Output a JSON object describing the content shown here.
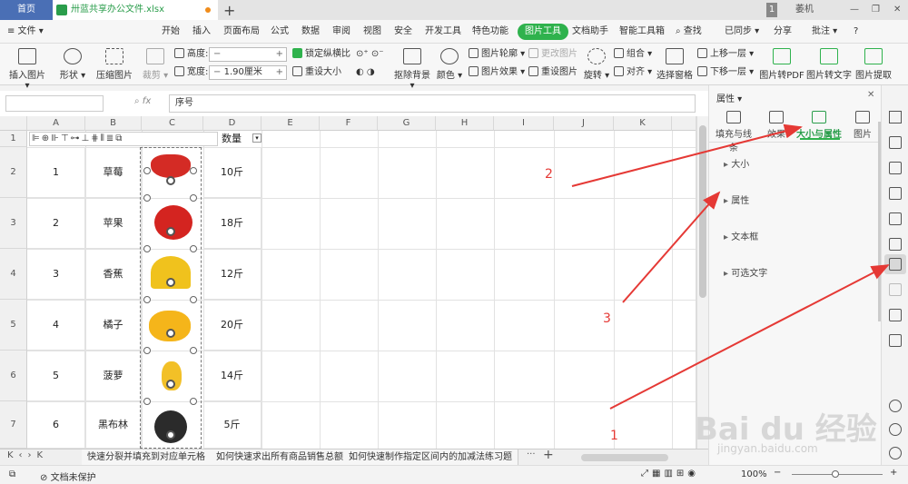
{
  "titlebar": {
    "home_tab": "首页",
    "file_tab": "卅蓝共享办公文件.xlsx",
    "plus": "+",
    "badge": "1",
    "user": "萎机"
  },
  "menubar": {
    "file": "≡ 文件 ▾",
    "items": [
      "开始",
      "插入",
      "页面布局",
      "公式",
      "数据",
      "审阅",
      "视图",
      "安全",
      "开发工具",
      "特色功能",
      "图片工具",
      "文档助手",
      "智能工具箱"
    ],
    "active": "图片工具",
    "search": "查找",
    "sync": "已同步 ▾",
    "share": "分享",
    "comment": "批注 ▾",
    "help": "?"
  },
  "ribbon": {
    "insert_pic": "插入图片 ▾",
    "shape": "形状 ▾",
    "compress": "压缩图片",
    "crop": "裁剪 ▾",
    "height_label": "高度:",
    "width_label": "宽度:",
    "height_value": "",
    "width_value": "1.90厘米",
    "lock_ratio": "锁定纵横比",
    "resize": "重设大小",
    "remove_bg": "抠除背景 ▾",
    "color": "颜色 ▾",
    "pic_outline": "图片轮廓 ▾",
    "pic_effect": "图片效果 ▾",
    "change_pic": "更改图片",
    "reset_pic": "重设图片",
    "rotate": "旋转 ▾",
    "group": "组合 ▾",
    "align": "对齐 ▾",
    "select_pane": "选择窗格",
    "bring_forward": "上移一层 ▾",
    "send_backward": "下移一层 ▾",
    "to_pdf": "图片转PDF",
    "to_text": "图片转文字",
    "extract": "图片提取"
  },
  "formula": {
    "fx": "fx",
    "value": "序号"
  },
  "grid": {
    "columns": [
      "A",
      "B",
      "C",
      "D",
      "E",
      "F",
      "G",
      "H",
      "I",
      "J",
      "K"
    ],
    "row_numbers": [
      "1",
      "2",
      "3",
      "4",
      "5",
      "6",
      "7"
    ],
    "header_qty": "数量",
    "rows": [
      {
        "no": "1",
        "name": "草莓",
        "qty": "10斤"
      },
      {
        "no": "2",
        "name": "苹果",
        "qty": "18斤"
      },
      {
        "no": "3",
        "name": "香蕉",
        "qty": "12斤"
      },
      {
        "no": "4",
        "name": "橘子",
        "qty": "20斤"
      },
      {
        "no": "5",
        "name": "菠萝",
        "qty": "14斤"
      },
      {
        "no": "6",
        "name": "黑布林",
        "qty": "5斤"
      }
    ]
  },
  "sheets": {
    "tabs": [
      "快速分裂并填充到对应单元格",
      "如何快速求出所有商品销售总额",
      "如何快速制作指定区间内的加减法练习题"
    ],
    "add": "+"
  },
  "status": {
    "doc_protect": "文档未保护",
    "zoom": "100%"
  },
  "panel": {
    "title": "属性 ▾",
    "tabs": [
      "填充与线条",
      "效果",
      "大小与属性",
      "图片"
    ],
    "active_tab": "大小与属性",
    "sections": [
      "大小",
      "属性",
      "文本框",
      "可选文字"
    ]
  },
  "annotations": {
    "n1": "1",
    "n2": "2",
    "n3": "3"
  },
  "watermark": {
    "logo": "Bai du 经验",
    "url": "jingyan.baidu.com"
  },
  "colors": {
    "accent": "#2fb24d",
    "home_tab": "#4a6fb5",
    "arrow": "#e53935"
  }
}
